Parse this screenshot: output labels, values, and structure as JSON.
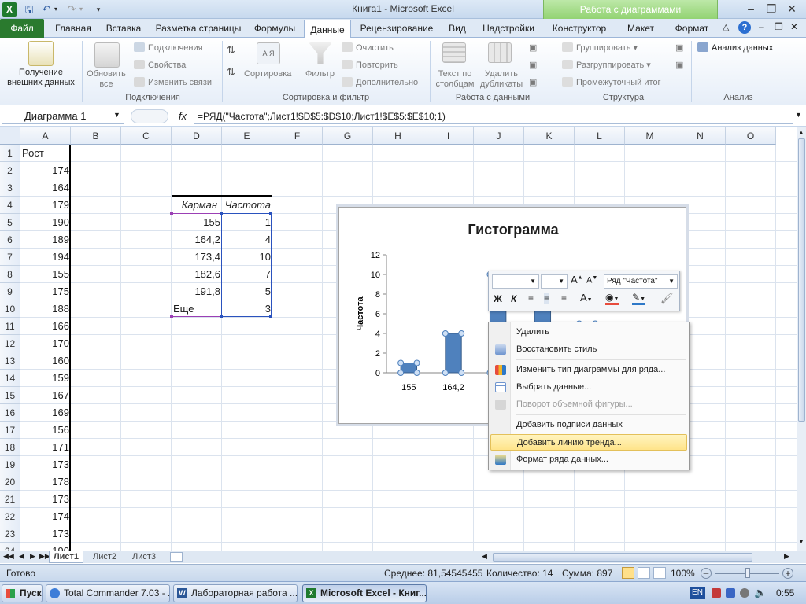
{
  "window": {
    "title": "Книга1 - Microsoft Excel",
    "context_header": "Работа с диаграммами"
  },
  "tabs": [
    "Файл",
    "Главная",
    "Вставка",
    "Разметка страницы",
    "Формулы",
    "Данные",
    "Рецензирование",
    "Вид",
    "Надстройки",
    "Конструктор",
    "Макет",
    "Формат"
  ],
  "ribbon": {
    "get_external": "Получение внешних данных",
    "refresh_all": "Обновить все",
    "connections": "Подключения",
    "properties": "Свойства",
    "edit_links": "Изменить связи",
    "group_connections": "Подключения",
    "sort_az": "А Я",
    "sort": "Сортировка",
    "filter": "Фильтр",
    "clear": "Очистить",
    "reapply": "Повторить",
    "advanced": "Дополнительно",
    "group_sort": "Сортировка и фильтр",
    "text_to_cols": "Текст по столбцам",
    "remove_dups": "Удалить дубликаты",
    "group_data": "Работа с данными",
    "group_btn": "Группировать",
    "ungroup": "Разгруппировать",
    "subtotal": "Промежуточный итог",
    "group_structure": "Структура",
    "analysis_btn": "Анализ данных",
    "group_analysis": "Анализ"
  },
  "formula_bar": {
    "name": "Диаграмма 1",
    "fx": "fx",
    "formula": "=РЯД(\"Частота\";Лист1!$D$5:$D$10;Лист1!$E$5:$E$10;1)"
  },
  "columns": [
    "A",
    "B",
    "C",
    "D",
    "E",
    "F",
    "G",
    "H",
    "I",
    "J",
    "K",
    "L",
    "M",
    "N",
    "O"
  ],
  "rows": [
    "1",
    "2",
    "3",
    "4",
    "5",
    "6",
    "7",
    "8",
    "9",
    "10",
    "11",
    "12",
    "13",
    "14",
    "15",
    "16",
    "17",
    "18",
    "19",
    "20",
    "21",
    "22",
    "23",
    "24"
  ],
  "col_a": [
    "Рост",
    "174",
    "164",
    "179",
    "190",
    "189",
    "194",
    "155",
    "175",
    "188",
    "166",
    "170",
    "160",
    "159",
    "167",
    "169",
    "156",
    "171",
    "173",
    "178",
    "173",
    "174",
    "173",
    "190"
  ],
  "bins_table": {
    "headers": [
      "Карман",
      "Частота"
    ],
    "rows": [
      [
        "155",
        "1"
      ],
      [
        "164,2",
        "4"
      ],
      [
        "173,4",
        "10"
      ],
      [
        "182,6",
        "7"
      ],
      [
        "191,8",
        "5"
      ],
      [
        "Еще",
        "3"
      ]
    ]
  },
  "chart_data": {
    "type": "bar",
    "title": "Гистограмма",
    "ylabel": "Частота",
    "xlabel": "",
    "categories": [
      "155",
      "164,2",
      "173,4",
      "182,6",
      "191,8",
      "Еще"
    ],
    "visible_tick_labels": [
      "155",
      "164,2",
      "173"
    ],
    "values": [
      1,
      4,
      10,
      7,
      5,
      3
    ],
    "yticks": [
      "0",
      "2",
      "4",
      "6",
      "8",
      "10",
      "12"
    ],
    "ylim": [
      0,
      12
    ],
    "bar_color": "#4f81bd",
    "grid": false
  },
  "mini_toolbar": {
    "series_select": "Ряд \"Частота\"",
    "bold": "Ж",
    "italic": "К"
  },
  "context_menu": [
    {
      "label": "Удалить",
      "enabled": true
    },
    {
      "label": "Восстановить стиль",
      "enabled": true
    },
    {
      "label": "Изменить тип диаграммы для ряда...",
      "enabled": true
    },
    {
      "label": "Выбрать данные...",
      "enabled": true
    },
    {
      "label": "Поворот объемной фигуры...",
      "enabled": false
    },
    {
      "label": "Добавить подписи данных",
      "enabled": true
    },
    {
      "label": "Добавить линию тренда...",
      "enabled": true,
      "highlighted": true
    },
    {
      "label": "Формат ряда данных...",
      "enabled": true
    }
  ],
  "sheets": [
    "Лист1",
    "Лист2",
    "Лист3"
  ],
  "status": {
    "ready": "Готово",
    "avg": "Среднее: 81,54545455",
    "count": "Количество: 14",
    "sum": "Сумма: 897",
    "zoom": "100%"
  },
  "taskbar": {
    "start": "Пуск",
    "items": [
      "Total Commander 7.03 - ...",
      "Лабораторная работа ...",
      "Microsoft Excel - Книг..."
    ],
    "lang": "EN",
    "clock": "0:55"
  }
}
